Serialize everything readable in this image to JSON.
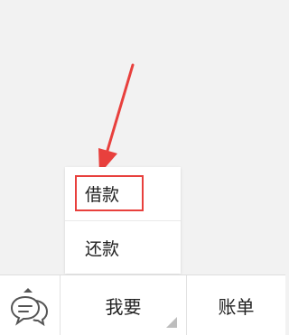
{
  "popup_menu": {
    "items": [
      {
        "label": "借款"
      },
      {
        "label": "还款"
      }
    ]
  },
  "bottom_bar": {
    "chat_icon": "chat-bubbles-icon",
    "want_label": "我要",
    "bill_label": "账单"
  },
  "colors": {
    "annotation_red": "#e8403d",
    "background": "#f2f2f2",
    "text": "#222222"
  }
}
